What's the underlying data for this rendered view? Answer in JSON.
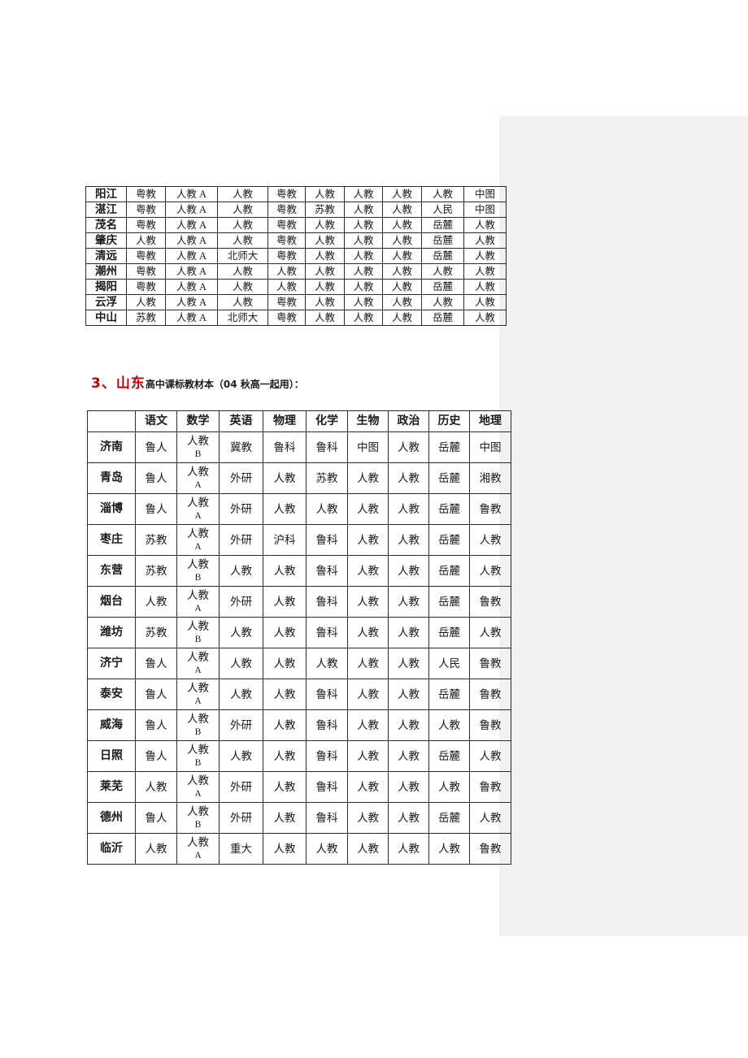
{
  "page": {
    "background_color": "#ffffff",
    "panel_color": "#f1f1f1"
  },
  "heading": {
    "number_region": "3、山东",
    "rest": "高中课标教材本（04 秋高一起用）：",
    "accent_color": "#c00000"
  },
  "table_guangdong": {
    "rows": [
      {
        "city": "阳江",
        "cells": [
          "粤教",
          "人教 A",
          "人教",
          "粤教",
          "人教",
          "人教",
          "人教",
          "人教",
          "中图"
        ]
      },
      {
        "city": "湛江",
        "cells": [
          "粤教",
          "人教 A",
          "人教",
          "粤教",
          "苏教",
          "人教",
          "人教",
          "人民",
          "中图"
        ]
      },
      {
        "city": "茂名",
        "cells": [
          "粤教",
          "人教 A",
          "人教",
          "粤教",
          "人教",
          "人教",
          "人教",
          "岳麓",
          "人教"
        ]
      },
      {
        "city": "肇庆",
        "cells": [
          "人教",
          "人教 A",
          "人教",
          "粤教",
          "人教",
          "人教",
          "人教",
          "岳麓",
          "人教"
        ]
      },
      {
        "city": "清远",
        "cells": [
          "粤教",
          "人教 A",
          "北师大",
          "粤教",
          "人教",
          "人教",
          "人教",
          "岳麓",
          "人教"
        ]
      },
      {
        "city": "潮州",
        "cells": [
          "粤教",
          "人教 A",
          "人教",
          "人教",
          "人教",
          "人教",
          "人教",
          "人教",
          "人教"
        ]
      },
      {
        "city": "揭阳",
        "cells": [
          "粤教",
          "人教 A",
          "人教",
          "人教",
          "人教",
          "人教",
          "人教",
          "岳麓",
          "人教"
        ]
      },
      {
        "city": "云浮",
        "cells": [
          "人教",
          "人教 A",
          "人教",
          "粤教",
          "人教",
          "人教",
          "人教",
          "人教",
          "人教"
        ]
      },
      {
        "city": "中山",
        "cells": [
          "苏教",
          "人教 A",
          "北师大",
          "粤教",
          "人教",
          "人教",
          "人教",
          "岳麓",
          "人教"
        ]
      }
    ]
  },
  "table_shandong": {
    "corner_label": "",
    "columns": [
      "语文",
      "数学",
      "英语",
      "物理",
      "化学",
      "生物",
      "政治",
      "历史",
      "地理"
    ],
    "rows": [
      {
        "city": "济南",
        "chinese": "鲁人",
        "math_main": "人教",
        "math_sub": "B",
        "english": "冀教",
        "physics": "鲁科",
        "chemistry": "鲁科",
        "biology": "中图",
        "politics": "人教",
        "history": "岳麓",
        "geography": "中图"
      },
      {
        "city": "青岛",
        "chinese": "鲁人",
        "math_main": "人教",
        "math_sub": "A",
        "english": "外研",
        "physics": "人教",
        "chemistry": "苏教",
        "biology": "人教",
        "politics": "人教",
        "history": "岳麓",
        "geography": "湘教"
      },
      {
        "city": "淄博",
        "chinese": "鲁人",
        "math_main": "人教",
        "math_sub": "A",
        "english": "外研",
        "physics": "人教",
        "chemistry": "人教",
        "biology": "人教",
        "politics": "人教",
        "history": "岳麓",
        "geography": "鲁教"
      },
      {
        "city": "枣庄",
        "chinese": "苏教",
        "math_main": "人教",
        "math_sub": "A",
        "english": "外研",
        "physics": "沪科",
        "chemistry": "鲁科",
        "biology": "人教",
        "politics": "人教",
        "history": "岳麓",
        "geography": "人教"
      },
      {
        "city": "东营",
        "chinese": "苏教",
        "math_main": "人教",
        "math_sub": "B",
        "english": "人教",
        "physics": "人教",
        "chemistry": "鲁科",
        "biology": "人教",
        "politics": "人教",
        "history": "岳麓",
        "geography": "人教"
      },
      {
        "city": "烟台",
        "chinese": "人教",
        "math_main": "人教",
        "math_sub": "A",
        "english": "外研",
        "physics": "人教",
        "chemistry": "鲁科",
        "biology": "人教",
        "politics": "人教",
        "history": "岳麓",
        "geography": "鲁教"
      },
      {
        "city": "潍坊",
        "chinese": "苏教",
        "math_main": "人教",
        "math_sub": "B",
        "english": "人教",
        "physics": "人教",
        "chemistry": "鲁科",
        "biology": "人教",
        "politics": "人教",
        "history": "岳麓",
        "geography": "人教"
      },
      {
        "city": "济宁",
        "chinese": "鲁人",
        "math_main": "人教",
        "math_sub": "A",
        "english": "人教",
        "physics": "人教",
        "chemistry": "人教",
        "biology": "人教",
        "politics": "人教",
        "history": "人民",
        "geography": "鲁教"
      },
      {
        "city": "泰安",
        "chinese": "鲁人",
        "math_main": "人教",
        "math_sub": "A",
        "english": "人教",
        "physics": "人教",
        "chemistry": "鲁科",
        "biology": "人教",
        "politics": "人教",
        "history": "岳麓",
        "geography": "鲁教"
      },
      {
        "city": "威海",
        "chinese": "鲁人",
        "math_main": "人教",
        "math_sub": "B",
        "english": "外研",
        "physics": "人教",
        "chemistry": "鲁科",
        "biology": "人教",
        "politics": "人教",
        "history": "人教",
        "geography": "鲁教"
      },
      {
        "city": "日照",
        "chinese": "鲁人",
        "math_main": "人教",
        "math_sub": "B",
        "english": "人教",
        "physics": "人教",
        "chemistry": "鲁科",
        "biology": "人教",
        "politics": "人教",
        "history": "岳麓",
        "geography": "人教"
      },
      {
        "city": "莱芜",
        "chinese": "人教",
        "math_main": "人教",
        "math_sub": "A",
        "english": "外研",
        "physics": "人教",
        "chemistry": "鲁科",
        "biology": "人教",
        "politics": "人教",
        "history": "人教",
        "geography": "鲁教"
      },
      {
        "city": "德州",
        "chinese": "鲁人",
        "math_main": "人教",
        "math_sub": "B",
        "english": "外研",
        "physics": "人教",
        "chemistry": "鲁科",
        "biology": "人教",
        "politics": "人教",
        "history": "岳麓",
        "geography": "人教"
      },
      {
        "city": "临沂",
        "chinese": "人教",
        "math_main": "人教",
        "math_sub": "A",
        "english": "重大",
        "physics": "人教",
        "chemistry": "人教",
        "biology": "人教",
        "politics": "人教",
        "history": "人教",
        "geography": "鲁教"
      }
    ]
  }
}
